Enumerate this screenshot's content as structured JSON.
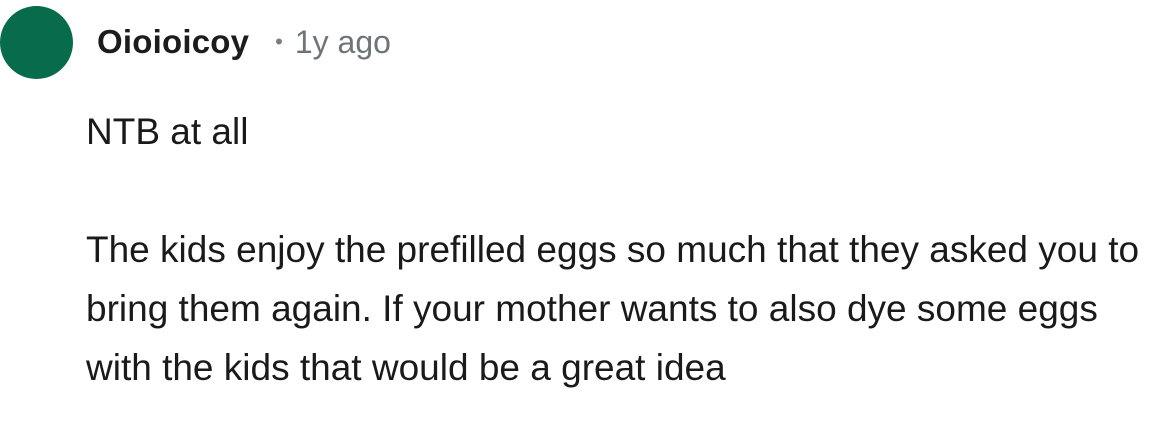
{
  "comment": {
    "avatar_color": "#086b4b",
    "username": "Oioioicoy",
    "separator": "•",
    "timestamp": "1y ago",
    "paragraphs": [
      "NTB at all",
      "The kids enjoy the prefilled eggs so much that they asked you to bring them again. If your mother wants to also dye some eggs with the kids that would be a great idea"
    ]
  }
}
